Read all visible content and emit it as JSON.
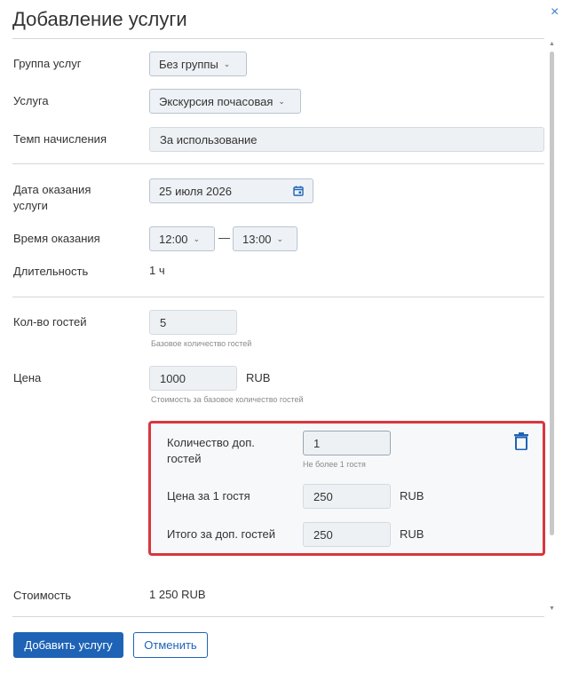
{
  "dialog": {
    "title": "Добавление услуги",
    "close_glyph": "×"
  },
  "form": {
    "service_group": {
      "label": "Группа услуг",
      "value": "Без группы"
    },
    "service": {
      "label": "Услуга",
      "value": "Экскурсия почасовая"
    },
    "charge_rate": {
      "label": "Темп начисления",
      "value": "За использование"
    },
    "date": {
      "label": "Дата оказания услуги",
      "value": "25 июля 2026"
    },
    "time": {
      "label": "Время оказания",
      "from": "12:00",
      "dash": "—",
      "to": "13:00"
    },
    "duration": {
      "label": "Длительность",
      "value": "1 ч"
    },
    "guests": {
      "label": "Кол-во гостей",
      "value": "5",
      "hint": "Базовое количество гостей"
    },
    "price": {
      "label": "Цена",
      "value": "1000",
      "unit": "RUB",
      "hint": "Стоимость за базовое количество гостей"
    },
    "extra_guests": {
      "count_label": "Количество доп. гостей",
      "count_value": "1",
      "count_hint": "Не более 1 гостя",
      "price_label": "Цена за 1 гостя",
      "price_value": "250",
      "price_unit": "RUB",
      "total_label": "Итого за доп. гостей",
      "total_value": "250",
      "total_unit": "RUB",
      "delete_icon": "trash-icon",
      "highlight_color": "#d9363e"
    },
    "cost": {
      "label": "Стоимость",
      "value": "1 250 RUB"
    }
  },
  "footer": {
    "add_label": "Добавить услугу",
    "cancel_label": "Отменить"
  },
  "colors": {
    "accent": "#1e63b5",
    "highlight": "#d9363e"
  }
}
